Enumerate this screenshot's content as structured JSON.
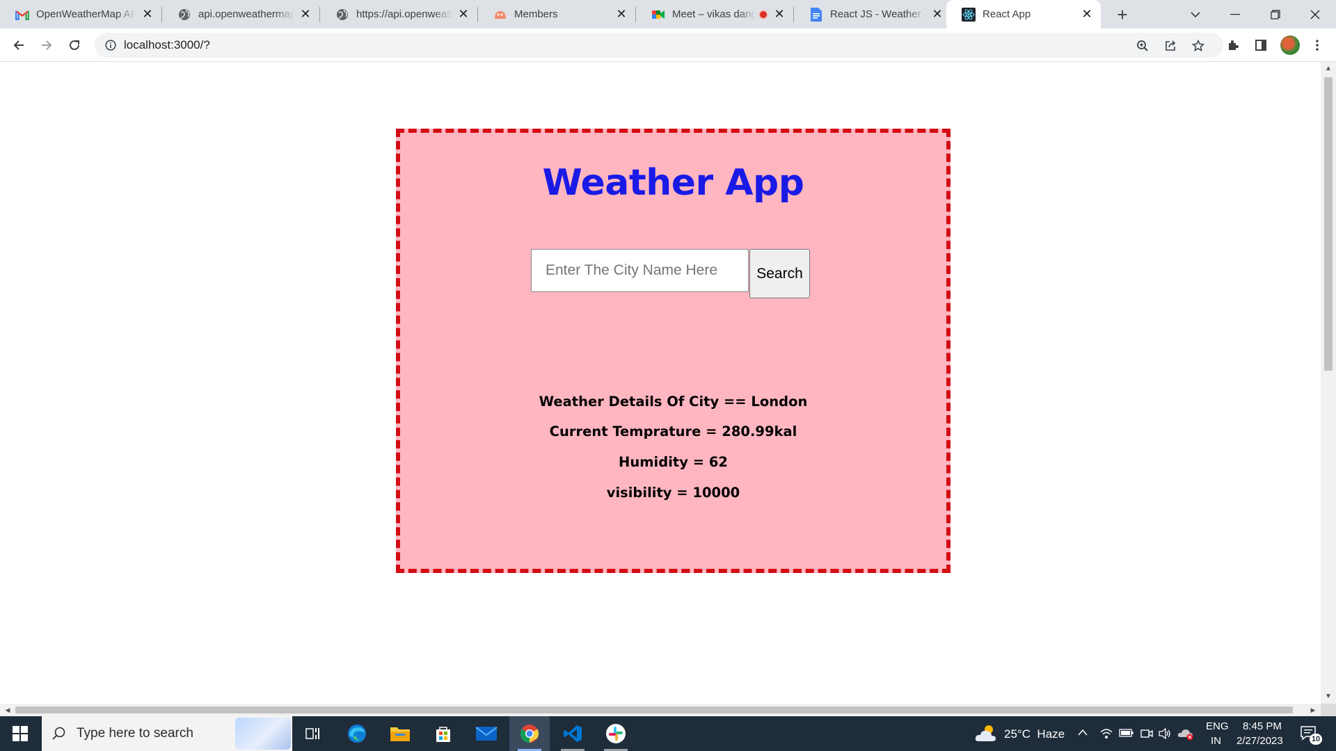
{
  "browser": {
    "tabs": [
      {
        "title": "OpenWeatherMap API",
        "icon": "gmail-icon",
        "active": false
      },
      {
        "title": "api.openweathermap.org",
        "icon": "globe-icon",
        "active": false
      },
      {
        "title": "https://api.openweathermap.org",
        "icon": "globe-icon",
        "active": false
      },
      {
        "title": "Members",
        "icon": "members-icon",
        "active": false
      },
      {
        "title": "Meet – vikas dang",
        "icon": "google-meet-icon",
        "active": false
      },
      {
        "title": "React JS - Weather App",
        "icon": "google-docs-icon",
        "active": false
      },
      {
        "title": "React App",
        "icon": "react-icon",
        "active": true
      }
    ],
    "url": "localhost:3000/?"
  },
  "app": {
    "title": "Weather App",
    "search": {
      "placeholder": "Enter The City Name Here",
      "value": "",
      "button_label": "Search"
    },
    "details": {
      "city_line": "Weather Details Of City == London",
      "temperature_line": "Current Temprature = 280.99kal",
      "humidity_line": "Humidity = 62",
      "visibility_line": "visibility = 10000"
    },
    "colors": {
      "card_bg": "#ffb6c1",
      "card_border": "#d40d14",
      "title": "#1a1ae6"
    }
  },
  "taskbar": {
    "search_placeholder": "Type here to search",
    "weather": "25°C  Haze",
    "language_line1": "ENG",
    "language_line2": "IN",
    "time": "8:45 PM",
    "date": "2/27/2023",
    "notification_count": "10"
  }
}
